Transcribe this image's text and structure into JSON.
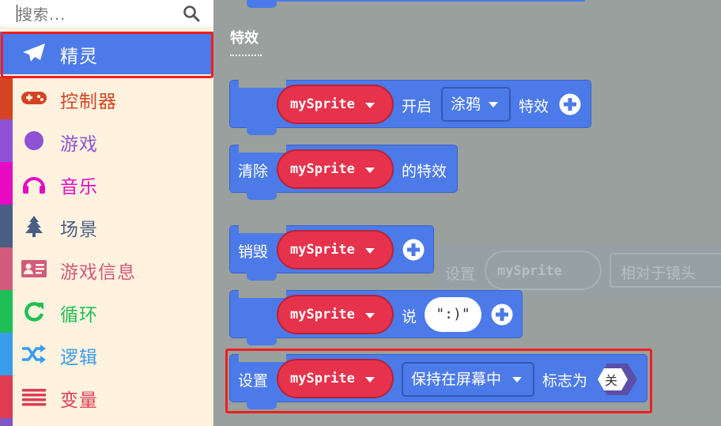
{
  "sidebar": {
    "search_placeholder": "搜索...",
    "categories": [
      {
        "label": "精灵",
        "color": "#4c7ae8",
        "icon": "paper-plane-icon"
      },
      {
        "label": "控制器",
        "color": "#d54322",
        "icon": "gamepad-icon"
      },
      {
        "label": "游戏",
        "color": "#8f52d4",
        "icon": "circle-icon"
      },
      {
        "label": "音乐",
        "color": "#e60ac3",
        "icon": "headphones-icon"
      },
      {
        "label": "场景",
        "color": "#4a5e85",
        "icon": "tree-icon"
      },
      {
        "label": "游戏信息",
        "color": "#d25a7d",
        "icon": "id-card-icon"
      },
      {
        "label": "循环",
        "color": "#20bf55",
        "icon": "refresh-icon"
      },
      {
        "label": "逻辑",
        "color": "#3a9ced",
        "icon": "shuffle-icon"
      },
      {
        "label": "变量",
        "color": "#dd3c53",
        "icon": "list-icon"
      }
    ]
  },
  "workspace": {
    "section_title": "特效",
    "ghost": {
      "label": "设置",
      "pill": "mySprite",
      "dropdown": "相对于镜头"
    },
    "blocks": {
      "start_effect": {
        "sprite": "mySprite",
        "label1": "开启",
        "dropdown": "涂鸦",
        "label2": "特效"
      },
      "clear_effect": {
        "label1": "清除",
        "sprite": "mySprite",
        "label2": "的特效"
      },
      "destroy": {
        "label1": "销毁",
        "sprite": "mySprite"
      },
      "say": {
        "sprite": "mySprite",
        "label1": "说",
        "text": "\":)\""
      },
      "set_flag": {
        "label1": "设置",
        "sprite": "mySprite",
        "dropdown": "保持在屏幕中",
        "label2": "标志为",
        "toggle": "关"
      }
    }
  }
}
